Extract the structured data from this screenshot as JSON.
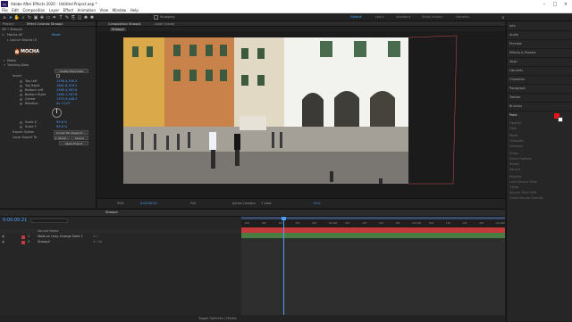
{
  "titlebar": {
    "logo": "Ae",
    "title": "Adobe After Effects 2020 - Untitled Project.aep *"
  },
  "menu": [
    "File",
    "Edit",
    "Composition",
    "Layer",
    "Effect",
    "Animation",
    "View",
    "Window",
    "Help"
  ],
  "toolbar": {
    "snapping_label": "Snapping"
  },
  "workspaces": [
    "Default",
    "Learn",
    "Standard",
    "Small Screen",
    "Libraries"
  ],
  "left_panel": {
    "tab_project": "Project",
    "tab_effect": "Effect Controls Stroop4",
    "breadcrumb": "3D • Stroop4",
    "effect_name": "Mocha AE",
    "reset_label": "Reset",
    "launch_label": "Launch Mocha UI",
    "logo_text": "MOCHA",
    "matte_label": "Matte",
    "tracking_label": "Tracking Data",
    "create_track_label": "Create Track Data",
    "params": [
      {
        "key": "Invert",
        "value": ""
      },
      {
        "key": "Top Left",
        "value": "1256.4,340.4"
      },
      {
        "key": "Top Right",
        "value": "1481.8,316.2"
      },
      {
        "key": "Bottom Left",
        "value": "1265.4,567.6"
      },
      {
        "key": "Bottom Right",
        "value": "1480.1,567.6"
      },
      {
        "key": "Center",
        "value": "1370.9,448.3"
      },
      {
        "key": "Rotation",
        "value": "0x +0.0°"
      },
      {
        "key": "Scale X",
        "value": "99.8 %"
      },
      {
        "key": "Scale Y",
        "value": "99.8 %"
      }
    ],
    "export_option_label": "Export Option",
    "export_option_value": "Corner Pin (Support ...",
    "layer_export_label": "Layer Export To",
    "layer_export_value": "1. Monit...",
    "layer_export_value2": "Source",
    "apply_export_label": "Apply Export"
  },
  "viewer": {
    "tab_composition": "Composition Stroop4",
    "tab_layer": "Layer (none)",
    "comp_name": "Stroop4",
    "zoom": "50%",
    "timecode": "0:00:00:21",
    "resolution": "Full",
    "camera": "Active Camera",
    "views": "1 View",
    "exposure": "+0.0"
  },
  "right_panel": {
    "items": [
      "Info",
      "Audio",
      "Preview",
      "Effects & Presets",
      "Align",
      "Libraries",
      "Character",
      "Paragraph",
      "Tracker",
      "Brushes",
      "Paint"
    ],
    "paint_fields": [
      "Opacity",
      "Flow",
      "Mode",
      "Channels",
      "Duration",
      "Erase",
      "Clone Options",
      "Preset",
      "Source",
      "Aligned",
      "Lock Source Time",
      "Offset",
      "Source Time Shift",
      "Clone Source Overlay"
    ],
    "paint_primary_color": "#e8101a",
    "paint_secondary_color": "#ffffff"
  },
  "timeline": {
    "tab_label": "Stroop4",
    "timecode": "0:00:00:21",
    "search_placeholder": "",
    "column_source": "Source Name",
    "layers": [
      {
        "num": "1",
        "name": "Medium Gray-Orange Solid 1",
        "color": "#c43a3a"
      },
      {
        "num": "2",
        "name": "Stroop4",
        "color": "#c43a3a"
      }
    ],
    "ruler_labels": [
      "00f",
      "05f",
      "10f",
      "15f",
      "20f",
      "01:00f",
      "05f",
      "10f",
      "15f",
      "20f",
      "02:00f",
      "05f",
      "10f",
      "15f",
      "20f",
      "03:00f"
    ],
    "bottom_label": "Toggle Switches / Modes",
    "playhead_progress": 0.16
  },
  "colors": {
    "accent": "#4aa0ff",
    "track_green": "#4a7d44",
    "track_red": "#c43a3a"
  }
}
